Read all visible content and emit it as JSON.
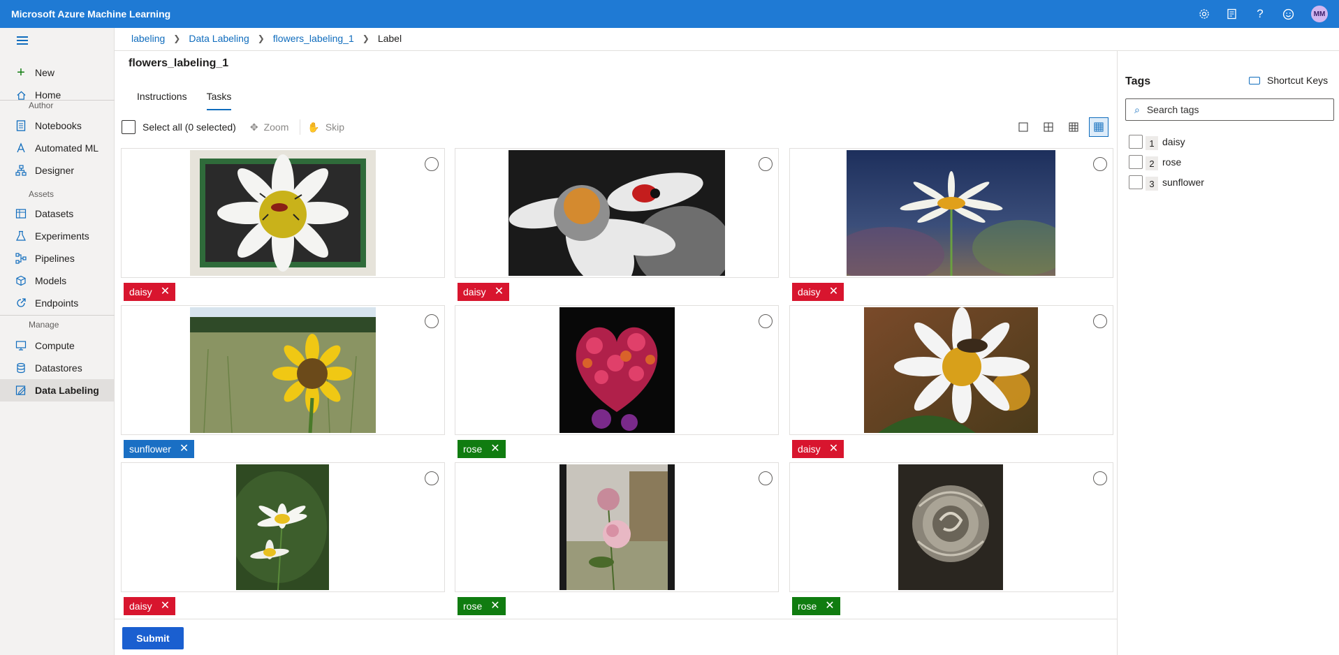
{
  "app": {
    "title": "Microsoft Azure Machine Learning",
    "avatar_initials": "MM",
    "header_icons": [
      "settings-icon",
      "feedback-icon",
      "help-icon",
      "smiley-icon"
    ]
  },
  "sidebar": {
    "items": [
      {
        "label": "New",
        "icon": "plus-icon"
      },
      {
        "label": "Home",
        "icon": "home-icon"
      },
      {
        "label": "Notebooks",
        "icon": "notebook-icon"
      },
      {
        "label": "Automated ML",
        "icon": "automl-icon"
      },
      {
        "label": "Designer",
        "icon": "designer-icon"
      },
      {
        "label": "Datasets",
        "icon": "dataset-icon"
      },
      {
        "label": "Experiments",
        "icon": "flask-icon"
      },
      {
        "label": "Pipelines",
        "icon": "pipeline-icon"
      },
      {
        "label": "Models",
        "icon": "cube-icon"
      },
      {
        "label": "Endpoints",
        "icon": "endpoint-icon"
      },
      {
        "label": "Compute",
        "icon": "monitor-icon"
      },
      {
        "label": "Datastores",
        "icon": "database-icon"
      },
      {
        "label": "Data Labeling",
        "icon": "labeling-icon"
      }
    ],
    "sections": {
      "author": "Author",
      "assets": "Assets",
      "manage": "Manage"
    }
  },
  "breadcrumb": [
    "labeling",
    "Data Labeling",
    "flowers_labeling_1",
    "Label"
  ],
  "project": {
    "title": "flowers_labeling_1"
  },
  "tabs": [
    "Instructions",
    "Tasks"
  ],
  "toolbar": {
    "select_all": "Select all (0 selected)",
    "zoom": "Zoom",
    "skip": "Skip"
  },
  "tasks": [
    {
      "tag": "daisy",
      "image": "daisy-with-beetle-framed"
    },
    {
      "tag": "daisy",
      "image": "daisy-with-ladybug-bw"
    },
    {
      "tag": "daisy",
      "image": "daisy-single-stem"
    },
    {
      "tag": "sunflower",
      "image": "sunflower-in-field"
    },
    {
      "tag": "rose",
      "image": "rose-heart-bouquet"
    },
    {
      "tag": "daisy",
      "image": "daisy-with-bee"
    },
    {
      "tag": "daisy",
      "image": "two-daisies"
    },
    {
      "tag": "rose",
      "image": "pink-roses-outdoor"
    },
    {
      "tag": "rose",
      "image": "rose-sepia"
    }
  ],
  "submit_label": "Submit",
  "right_panel": {
    "title": "Tags",
    "shortcut_keys": "Shortcut Keys",
    "search_placeholder": "Search tags",
    "tags": [
      {
        "num": "1",
        "label": "daisy"
      },
      {
        "num": "2",
        "label": "rose"
      },
      {
        "num": "3",
        "label": "sunflower"
      }
    ]
  },
  "colors": {
    "daisy": "#d8152e",
    "rose": "#107c10",
    "sunflower": "#1a6fc4",
    "brand": "#1f7ad4"
  }
}
